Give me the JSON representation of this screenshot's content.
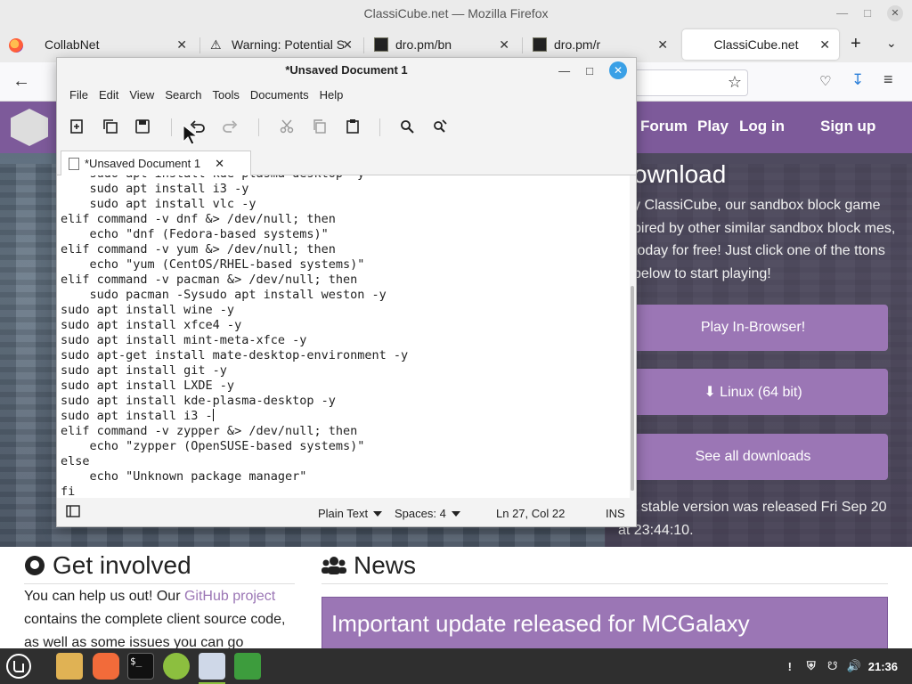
{
  "browser": {
    "window_title": "ClassiCube.net — Mozilla Firefox",
    "tabs": [
      {
        "label": "CollabNet",
        "icon": "firefox-icon"
      },
      {
        "label": "Warning: Potential S",
        "icon": "warning-icon"
      },
      {
        "label": "dro.pm/bn",
        "icon": "terminal-favicon"
      },
      {
        "label": "dro.pm/r",
        "icon": "terminal-favicon"
      },
      {
        "label": "ClassiCube.net",
        "icon": ""
      }
    ]
  },
  "website": {
    "nav": {
      "forum": "Forum",
      "play": "Play",
      "login": "Log in",
      "signup": "Sign up"
    },
    "download_title": "ownload",
    "download_text": "y ClassiCube, our sandbox block game pired by other similar sandbox block mes, today for free! Just click one of the ttons below to start playing!",
    "buttons": {
      "play_browser": "Play In-Browser!",
      "linux": "⬇ Linux (64 bit)",
      "all": "See all downloads"
    },
    "release_note": "est stable version was released Fri Sep 20 at 23:44:10.",
    "get_involved_title": "Get involved",
    "get_involved_pre": "You can help us out! Our ",
    "get_involved_link": "GitHub project",
    "get_involved_post": " contains the complete client source code, as well as some issues you can go",
    "news_title": "News",
    "news_item": "Important update released for MCGalaxy"
  },
  "editor": {
    "window_title": "*Unsaved Document 1",
    "menu": [
      "File",
      "Edit",
      "View",
      "Search",
      "Tools",
      "Documents",
      "Help"
    ],
    "tab_label": "*Unsaved Document 1",
    "lines_before_caret": [
      "    sudo apt install kde-plasma-desktop -y",
      "    sudo apt install i3 -y",
      "    sudo apt install vlc -y",
      "elif command -v dnf &> /dev/null; then",
      "    echo \"dnf (Fedora-based systems)\"",
      "elif command -v yum &> /dev/null; then",
      "    echo \"yum (CentOS/RHEL-based systems)\"",
      "elif command -v pacman &> /dev/null; then",
      "    sudo pacman -Sysudo apt install weston -y",
      "sudo apt install wine -y",
      "sudo apt install xfce4 -y",
      "sudo apt install mint-meta-xfce -y",
      "sudo apt-get install mate-desktop-environment -y",
      "sudo apt install git -y",
      "sudo apt install LXDE -y",
      "sudo apt install kde-plasma-desktop -y"
    ],
    "caret_line": "sudo apt install i3 -",
    "lines_after_caret": [
      "elif command -v zypper &> /dev/null; then",
      "    echo \"zypper (OpenSUSE-based systems)\"",
      "else",
      "    echo \"Unknown package manager\"",
      "fi"
    ],
    "status": {
      "syntax": "Plain Text",
      "indent": "Spaces: 4",
      "position": "Ln 27, Col 22",
      "mode": "INS"
    }
  },
  "taskbar": {
    "clock": "21:36",
    "apps": [
      "menu-icon",
      "files-icon",
      "firefox-icon",
      "terminal-icon",
      "calculator-icon",
      "text-editor-icon",
      "shield-icon"
    ]
  },
  "colors": {
    "brand_purple": "#7d5a9a",
    "button_purple": "#9b76b5",
    "accent_green": "#8cbf3f"
  }
}
